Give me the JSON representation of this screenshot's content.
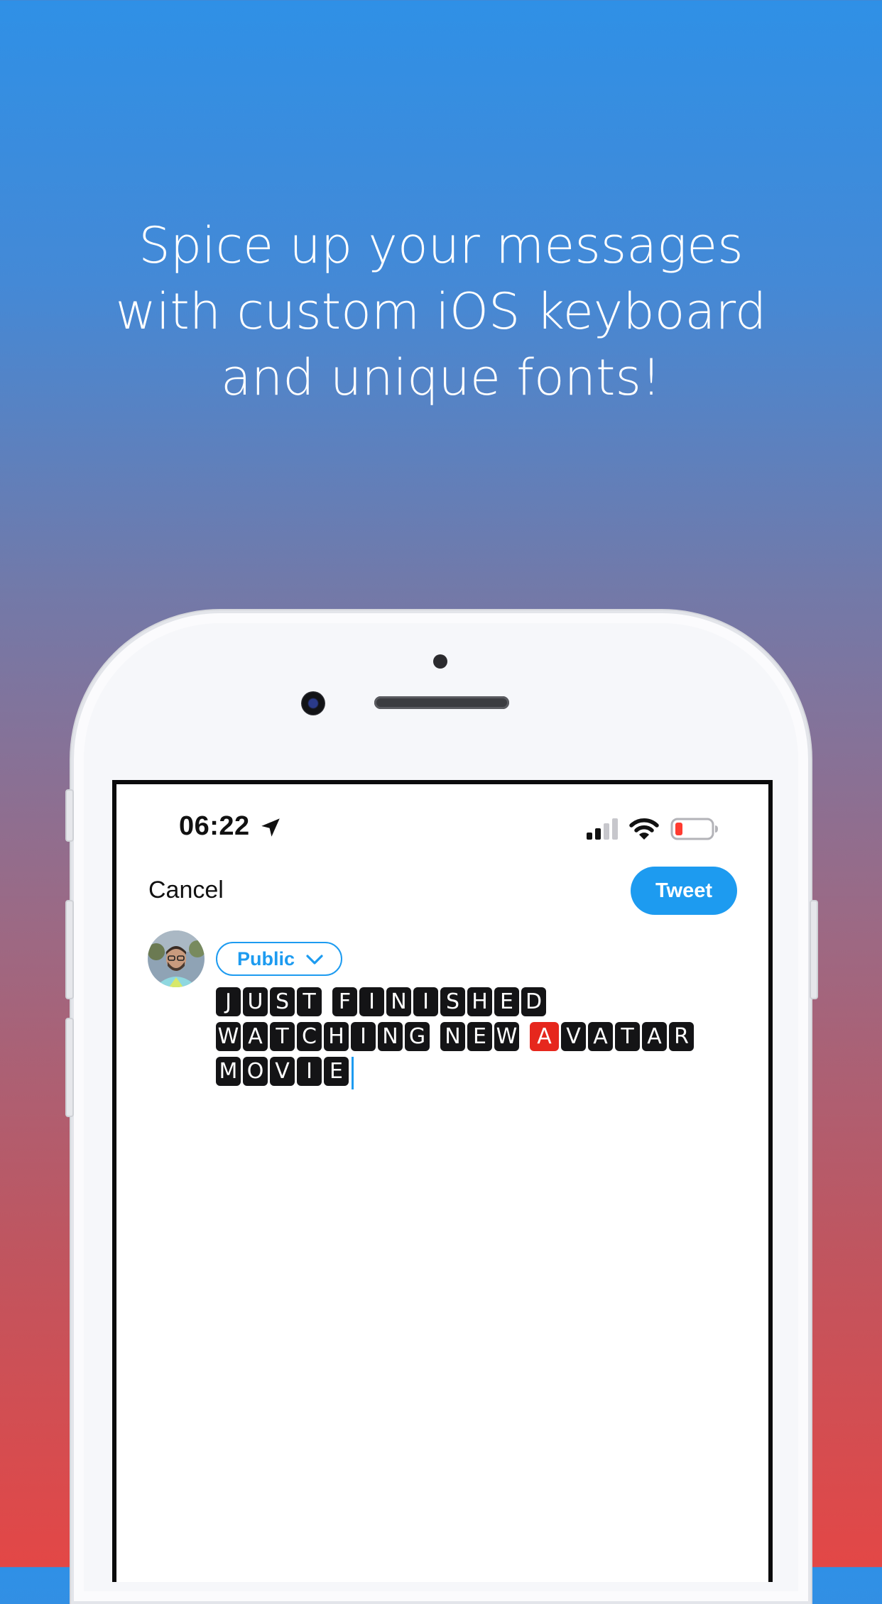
{
  "headline": {
    "line1": "Spice up your messages",
    "line2": "with custom iOS keyboard",
    "line3": "and unique fonts!"
  },
  "status_bar": {
    "time": "06:22",
    "location_icon": "location-arrow-icon",
    "signal_icon": "cellular-signal-icon",
    "wifi_icon": "wifi-icon",
    "battery_icon": "battery-low-icon"
  },
  "compose": {
    "cancel_label": "Cancel",
    "tweet_label": "Tweet",
    "audience_label": "Public",
    "tweet_lines": [
      "JUST FINISHED",
      "WATCHING NEW AVATAR",
      "MOVIE"
    ],
    "highlighted_letter": "A"
  },
  "colors": {
    "accent": "#1d9bf0",
    "highlight_tile": "#e6271d",
    "tile": "#141416"
  }
}
